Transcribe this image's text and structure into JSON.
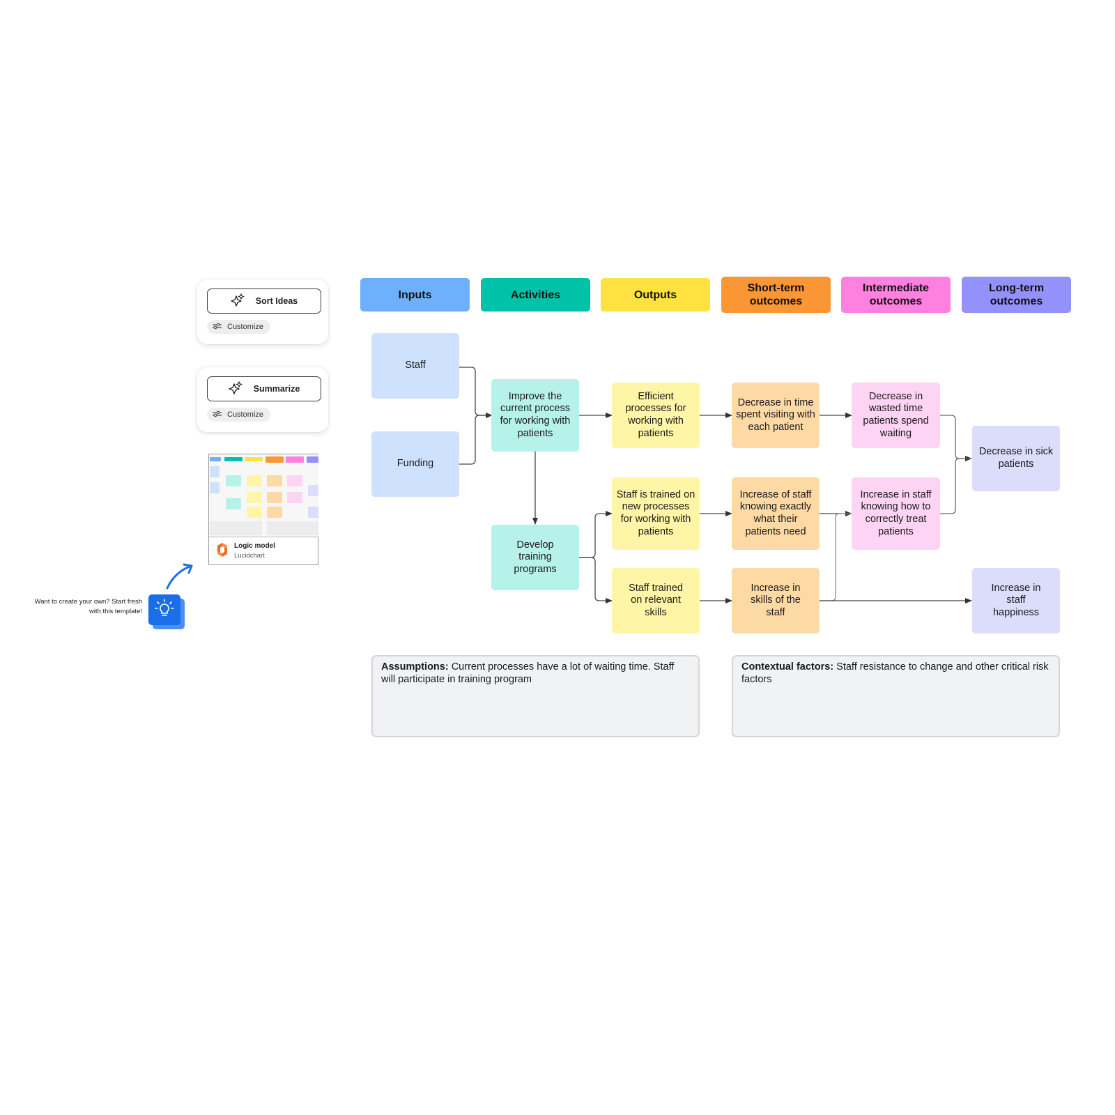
{
  "ai_panels": {
    "sort": {
      "label": "Sort Ideas",
      "customize": "Customize",
      "icon": "sparkle-icon"
    },
    "summarize": {
      "label": "Summarize",
      "customize": "Customize",
      "icon": "sparkle-icon"
    }
  },
  "template_card": {
    "title": "Logic model",
    "subtitle": "Lucidchart"
  },
  "hint": {
    "line1": "Want to create your own? Start fresh",
    "line2": "with this template!",
    "icon": "lightbulb-icon"
  },
  "colors": {
    "inputs": "#6fb0fd",
    "activities": "#00c2a8",
    "outputs": "#ffe240",
    "short_term": "#fb9634",
    "intermediate": "#ff80df",
    "long_term": "#9391fc"
  },
  "headers": {
    "inputs": "Inputs",
    "activities": "Activities",
    "outputs": "Outputs",
    "short_term": [
      "Short-term",
      "outcomes"
    ],
    "intermediate": [
      "Intermediate",
      "outcomes"
    ],
    "long_term": [
      "Long-term",
      "outcomes"
    ]
  },
  "nodes": {
    "staff": "Staff",
    "funding": "Funding",
    "improve_process": "Improve the current process for working with patients",
    "develop_training": "Develop training programs",
    "efficient_processes": "Efficient processes for working with patients",
    "staff_trained_new": "Staff is trained on new processes for working with patients",
    "staff_trained_skills": "Staff trained on relevant skills",
    "decrease_time_visiting": "Decrease in time spent visiting with each patient",
    "increase_knowing_needs": "Increase of staff knowing exactly what their patients need",
    "increase_skills": "Increase in skills of the staff",
    "decrease_wasted_time": "Decrease in wasted time patients spend waiting",
    "increase_knowing_treat": "Increase in staff knowing how to correctly treat patients",
    "decrease_sick": "Decrease in sick patients",
    "increase_happiness": "Increase in staff happiness"
  },
  "notes": {
    "assumptions": {
      "label": "Assumptions:",
      "text": " Current processes have a lot of waiting time. Staff will participate in training program"
    },
    "contextual": {
      "label": "Contextual factors:",
      "text": " Staff resistance to change and other critical risk factors"
    }
  }
}
